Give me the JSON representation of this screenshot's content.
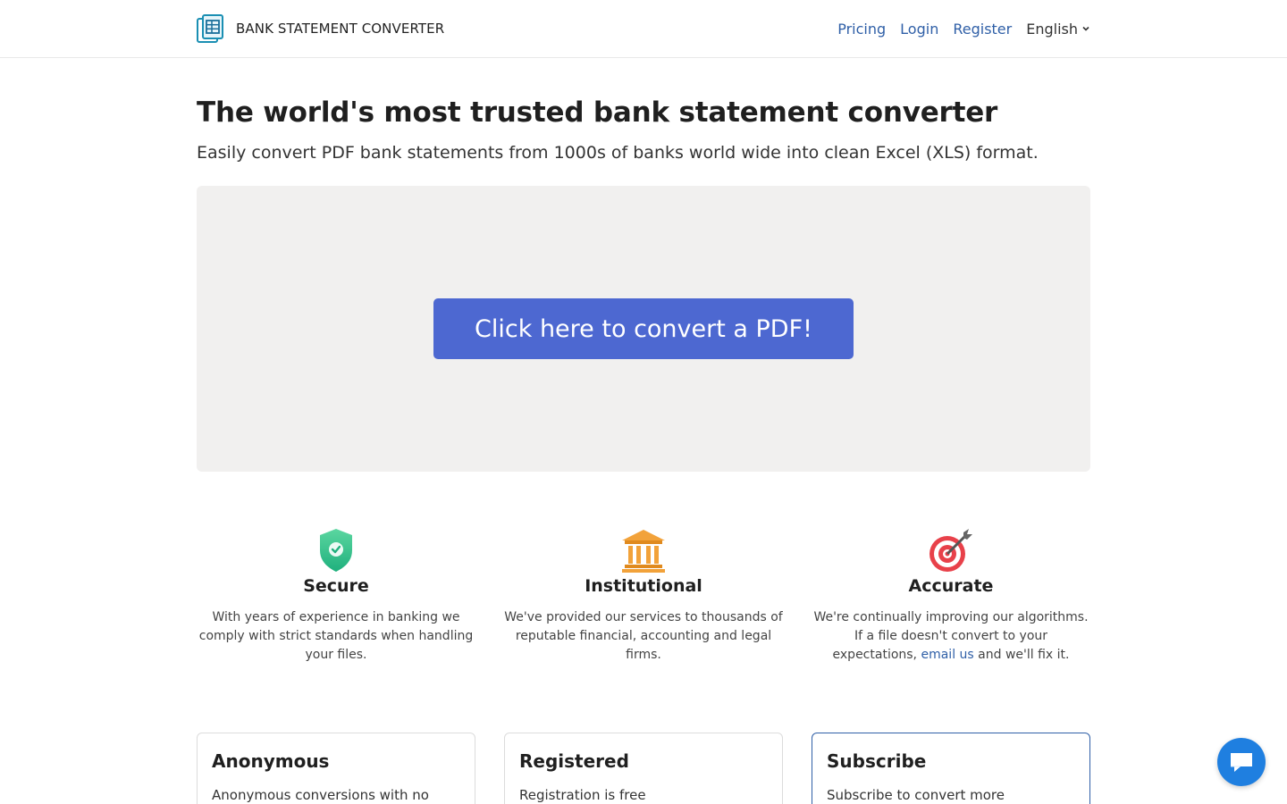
{
  "header": {
    "brand": "BANK STATEMENT CONVERTER",
    "nav": {
      "pricing": "Pricing",
      "login": "Login",
      "register": "Register"
    },
    "language": "English"
  },
  "hero": {
    "title": "The world's most trusted bank statement converter",
    "subtitle": "Easily convert PDF bank statements from 1000s of banks world wide into clean Excel (XLS) format."
  },
  "dropzone": {
    "button_label": "Click here to convert a PDF!"
  },
  "features": [
    {
      "title": "Secure",
      "icon": "shield-check-icon",
      "text": "With years of experience in banking we comply with strict standards when handling your files."
    },
    {
      "title": "Institutional",
      "icon": "bank-building-icon",
      "text": "We've provided our services to thousands of reputable financial, accounting and legal firms."
    },
    {
      "title": "Accurate",
      "icon": "target-dart-icon",
      "text_before": "We're continually improving our algorithms. If a file doesn't convert to your expectations, ",
      "link": "email us",
      "text_after": " and we'll fix it."
    }
  ],
  "plans": [
    {
      "title": "Anonymous",
      "text": "Anonymous conversions with no"
    },
    {
      "title": "Registered",
      "text": "Registration is free"
    },
    {
      "title": "Subscribe",
      "text": "Subscribe to convert more"
    }
  ],
  "colors": {
    "accent": "#4d68d1",
    "link": "#2f5fa7",
    "dropzone_bg": "#f1f0ef",
    "chat": "#1f7fe0"
  }
}
